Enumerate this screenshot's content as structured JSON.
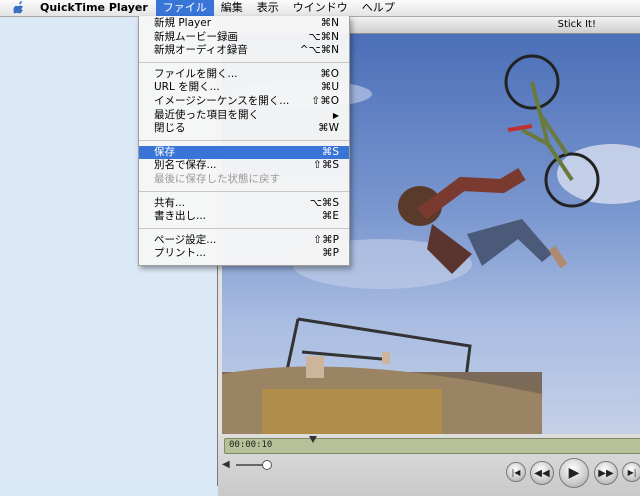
{
  "menubar": {
    "app_name": "QuickTime Player",
    "menus": [
      "ファイル",
      "編集",
      "表示",
      "ウインドウ",
      "ヘルプ"
    ],
    "active_menu": "ファイル"
  },
  "window": {
    "title": "Stick It!",
    "timecode": "00:00:10",
    "video_description_icon": "movie-frame"
  },
  "file_menu": {
    "new_player": {
      "label": "新規 Player",
      "shortcut": "⌘N"
    },
    "new_movie_recording": {
      "label": "新規ムービー録画",
      "shortcut": "⌥⌘N"
    },
    "new_audio_recording": {
      "label": "新規オーディオ録音",
      "shortcut": "^⌥⌘N"
    },
    "open_file": {
      "label": "ファイルを開く...",
      "shortcut": "⌘O"
    },
    "open_url": {
      "label": "URL を開く...",
      "shortcut": "⌘U"
    },
    "open_image_sequence": {
      "label": "イメージシーケンスを開く...",
      "shortcut": "⇧⌘O"
    },
    "open_recent": {
      "label": "最近使った項目を開く",
      "shortcut": "▶"
    },
    "close": {
      "label": "閉じる",
      "shortcut": "⌘W"
    },
    "save": {
      "label": "保存",
      "shortcut": "⌘S"
    },
    "save_as": {
      "label": "別名で保存...",
      "shortcut": "⇧⌘S"
    },
    "revert": {
      "label": "最後に保存した状態に戻す",
      "shortcut": ""
    },
    "share": {
      "label": "共有...",
      "shortcut": "⌥⌘S"
    },
    "export": {
      "label": "書き出し...",
      "shortcut": "⌘E"
    },
    "page_setup": {
      "label": "ページ設定...",
      "shortcut": "⇧⌘P"
    },
    "print": {
      "label": "プリント...",
      "shortcut": "⌘P"
    }
  },
  "colors": {
    "selection": "#3875d7",
    "sky": "#6f8ccb"
  }
}
